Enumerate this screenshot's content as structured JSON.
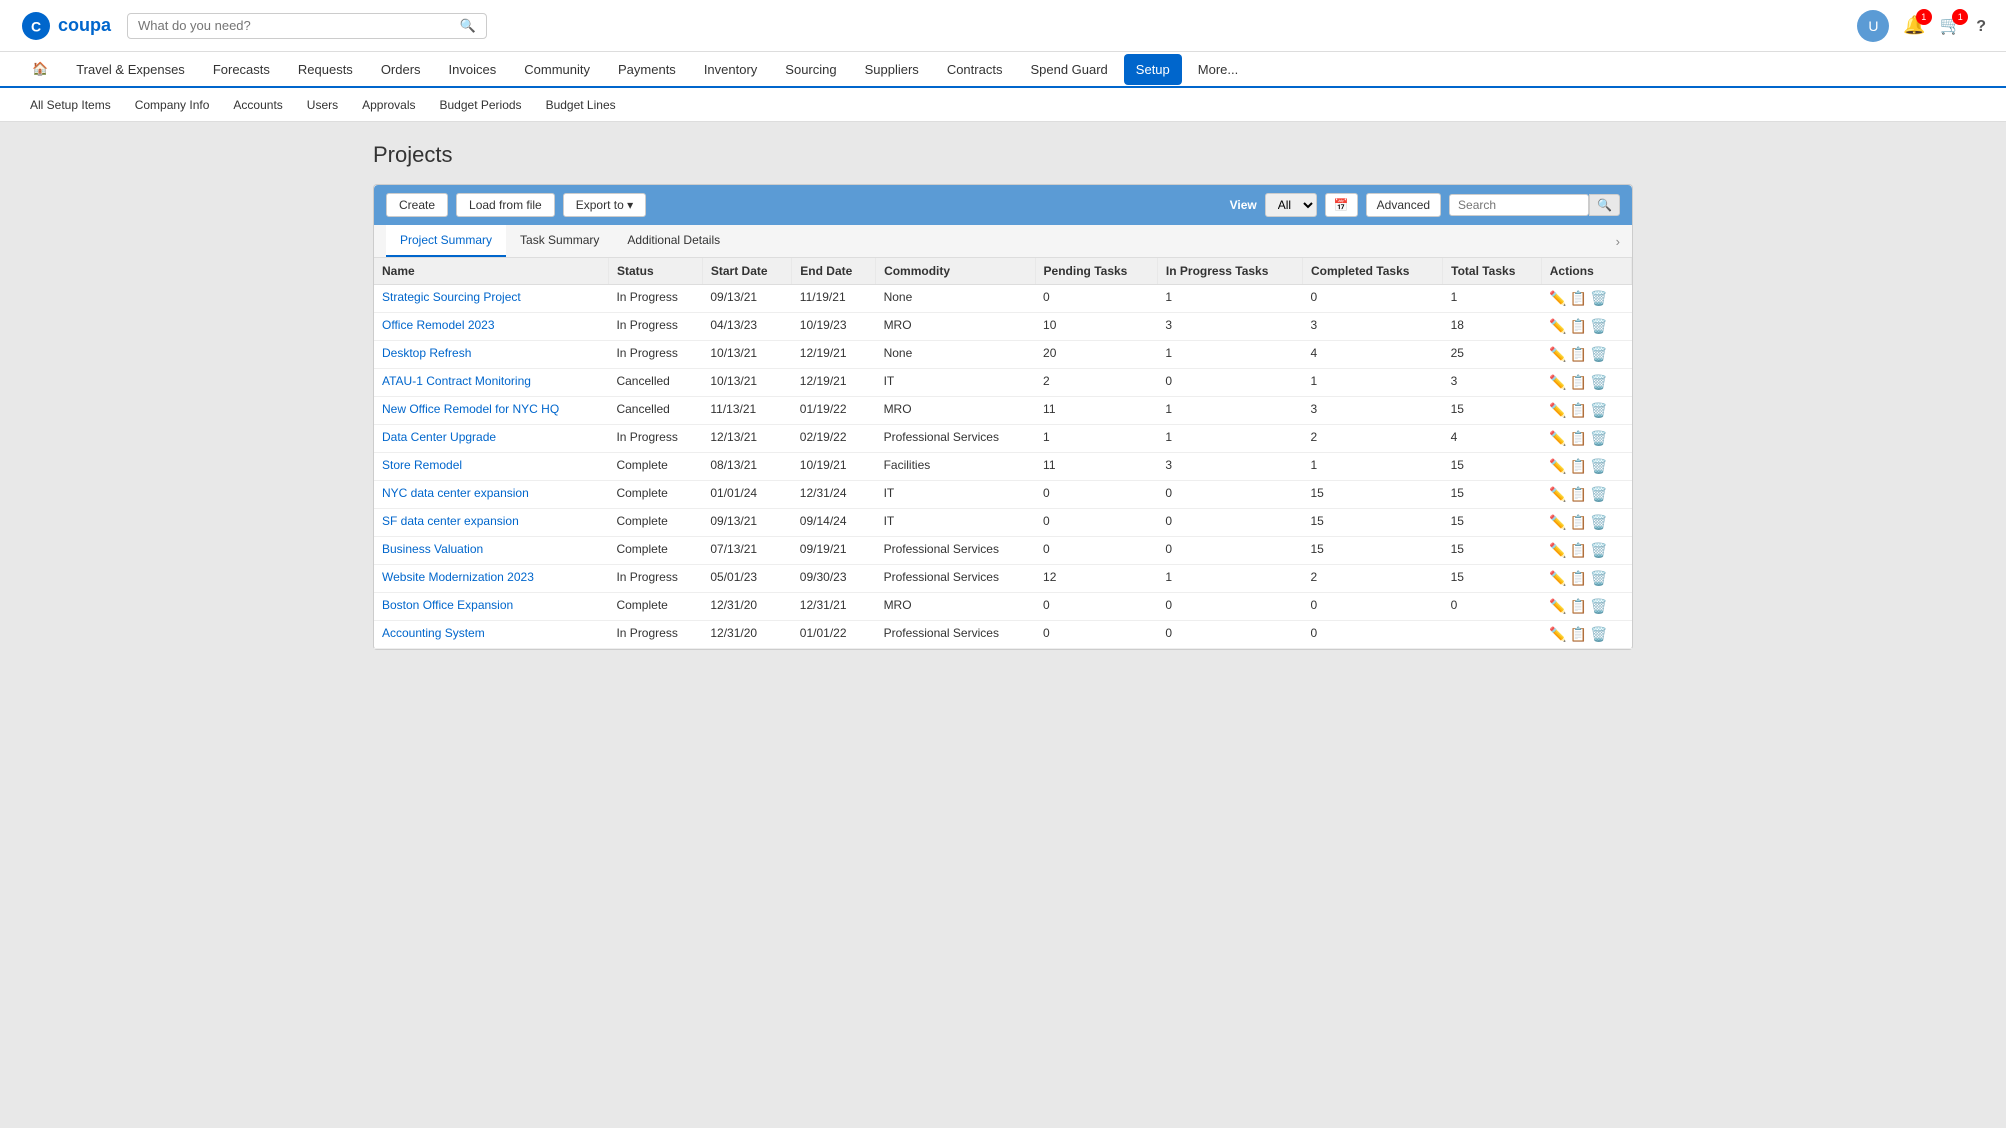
{
  "app": {
    "name": "coupa",
    "search_placeholder": "What do you need?"
  },
  "primary_nav": {
    "items": [
      {
        "label": "🏠",
        "key": "home",
        "active": false
      },
      {
        "label": "Travel & Expenses",
        "key": "travel",
        "active": false
      },
      {
        "label": "Forecasts",
        "key": "forecasts",
        "active": false
      },
      {
        "label": "Requests",
        "key": "requests",
        "active": false
      },
      {
        "label": "Orders",
        "key": "orders",
        "active": false
      },
      {
        "label": "Invoices",
        "key": "invoices",
        "active": false
      },
      {
        "label": "Community",
        "key": "community",
        "active": false
      },
      {
        "label": "Payments",
        "key": "payments",
        "active": false
      },
      {
        "label": "Inventory",
        "key": "inventory",
        "active": false
      },
      {
        "label": "Sourcing",
        "key": "sourcing",
        "active": false
      },
      {
        "label": "Suppliers",
        "key": "suppliers",
        "active": false
      },
      {
        "label": "Contracts",
        "key": "contracts",
        "active": false
      },
      {
        "label": "Spend Guard",
        "key": "spendguard",
        "active": false
      },
      {
        "label": "Setup",
        "key": "setup",
        "active": true
      },
      {
        "label": "More...",
        "key": "more",
        "active": false
      }
    ]
  },
  "secondary_nav": {
    "items": [
      {
        "label": "All Setup Items",
        "key": "all",
        "active": false
      },
      {
        "label": "Company Info",
        "key": "company",
        "active": false
      },
      {
        "label": "Accounts",
        "key": "accounts",
        "active": false
      },
      {
        "label": "Users",
        "key": "users",
        "active": false
      },
      {
        "label": "Approvals",
        "key": "approvals",
        "active": false
      },
      {
        "label": "Budget Periods",
        "key": "budget_periods",
        "active": false
      },
      {
        "label": "Budget Lines",
        "key": "budget_lines",
        "active": false
      }
    ]
  },
  "page": {
    "title": "Projects"
  },
  "toolbar": {
    "create_label": "Create",
    "load_label": "Load from file",
    "export_label": "Export to ▾",
    "view_label": "View",
    "view_options": [
      "All"
    ],
    "view_selected": "All",
    "advanced_label": "Advanced",
    "search_placeholder": "Search"
  },
  "tabs": [
    {
      "label": "Project Summary",
      "active": true
    },
    {
      "label": "Task Summary",
      "active": false
    },
    {
      "label": "Additional Details",
      "active": false
    }
  ],
  "table": {
    "columns": [
      "Name",
      "Status",
      "Start Date",
      "End Date",
      "Commodity",
      "Pending Tasks",
      "In Progress Tasks",
      "Completed Tasks",
      "Total Tasks",
      "Actions"
    ],
    "rows": [
      {
        "name": "Strategic Sourcing Project",
        "status": "In Progress",
        "start": "09/13/21",
        "end": "11/19/21",
        "commodity": "None",
        "pending": "0",
        "in_progress": "1",
        "completed": "0",
        "total": "1"
      },
      {
        "name": "Office Remodel 2023",
        "status": "In Progress",
        "start": "04/13/23",
        "end": "10/19/23",
        "commodity": "MRO",
        "pending": "10",
        "in_progress": "3",
        "completed": "3",
        "total": "18"
      },
      {
        "name": "Desktop Refresh",
        "status": "In Progress",
        "start": "10/13/21",
        "end": "12/19/21",
        "commodity": "None",
        "pending": "20",
        "in_progress": "1",
        "completed": "4",
        "total": "25"
      },
      {
        "name": "ATAU-1 Contract Monitoring",
        "status": "Cancelled",
        "start": "10/13/21",
        "end": "12/19/21",
        "commodity": "IT",
        "pending": "2",
        "in_progress": "0",
        "completed": "1",
        "total": "3"
      },
      {
        "name": "New Office Remodel for NYC HQ",
        "status": "Cancelled",
        "start": "11/13/21",
        "end": "01/19/22",
        "commodity": "MRO",
        "pending": "11",
        "in_progress": "1",
        "completed": "3",
        "total": "15"
      },
      {
        "name": "Data Center Upgrade",
        "status": "In Progress",
        "start": "12/13/21",
        "end": "02/19/22",
        "commodity": "Professional Services",
        "pending": "1",
        "in_progress": "1",
        "completed": "2",
        "total": "4"
      },
      {
        "name": "Store Remodel",
        "status": "Complete",
        "start": "08/13/21",
        "end": "10/19/21",
        "commodity": "Facilities",
        "pending": "11",
        "in_progress": "3",
        "completed": "1",
        "total": "15"
      },
      {
        "name": "NYC data center expansion",
        "status": "Complete",
        "start": "01/01/24",
        "end": "12/31/24",
        "commodity": "IT",
        "pending": "0",
        "in_progress": "0",
        "completed": "15",
        "total": "15"
      },
      {
        "name": "SF data center expansion",
        "status": "Complete",
        "start": "09/13/21",
        "end": "09/14/24",
        "commodity": "IT",
        "pending": "0",
        "in_progress": "0",
        "completed": "15",
        "total": "15"
      },
      {
        "name": "Business Valuation",
        "status": "Complete",
        "start": "07/13/21",
        "end": "09/19/21",
        "commodity": "Professional Services",
        "pending": "0",
        "in_progress": "0",
        "completed": "15",
        "total": "15"
      },
      {
        "name": "Website Modernization 2023",
        "status": "In Progress",
        "start": "05/01/23",
        "end": "09/30/23",
        "commodity": "Professional Services",
        "pending": "12",
        "in_progress": "1",
        "completed": "2",
        "total": "15"
      },
      {
        "name": "Boston Office Expansion",
        "status": "Complete",
        "start": "12/31/20",
        "end": "12/31/21",
        "commodity": "MRO",
        "pending": "0",
        "in_progress": "0",
        "completed": "0",
        "total": "0"
      },
      {
        "name": "Accounting System",
        "status": "In Progress",
        "start": "12/31/20",
        "end": "01/01/22",
        "commodity": "Professional Services",
        "pending": "0",
        "in_progress": "0",
        "completed": "0",
        "total": ""
      }
    ]
  },
  "badges": {
    "notifications": "1",
    "cart": "1"
  }
}
